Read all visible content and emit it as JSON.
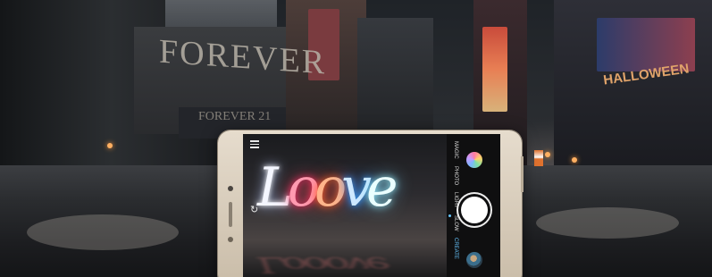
{
  "scene": {
    "sign_forever": "FOREVER",
    "sign_forever_small": "FOREVER 21",
    "sign_halloween": "HALLOWEEN"
  },
  "photo": {
    "light_painting_text": "Looove"
  },
  "camera": {
    "modes": [
      "MAGIC",
      "PHOTO",
      "LIGHT",
      "SLOW",
      "CREATE"
    ],
    "active_mode_index": 4,
    "icons": {
      "menu": "menu-icon",
      "rotate": "rotate-camera-icon",
      "filter": "filter-icon",
      "shutter": "shutter-button",
      "gallery": "gallery-thumbnail"
    }
  },
  "colors": {
    "phone_frame": "#d9cdb9",
    "active_mode": "#67c6ff",
    "neon_pink": "#ff2d66",
    "neon_blue": "#2f7dff"
  }
}
